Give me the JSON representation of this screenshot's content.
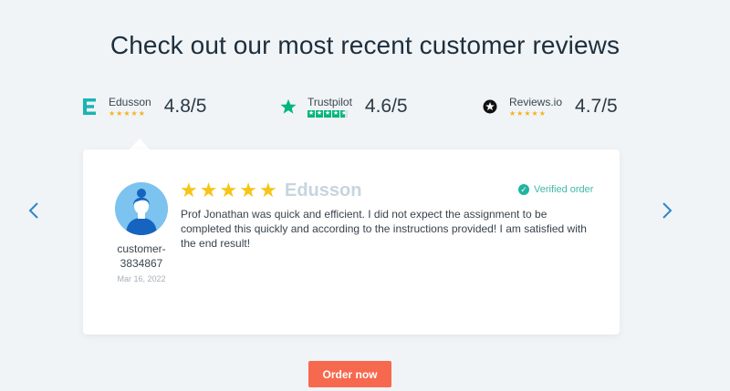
{
  "heading": "Check out our most recent customer reviews",
  "ratings": [
    {
      "name": "Edusson",
      "score": "4.8/5",
      "icon": "edusson-e-icon",
      "color": "#1bb3b6"
    },
    {
      "name": "Trustpilot",
      "score": "4.6/5",
      "icon": "trustpilot-star-icon",
      "color": "#00b67a"
    },
    {
      "name": "Reviews.io",
      "score": "4.7/5",
      "icon": "reviewsio-star-icon",
      "color": "#111111"
    }
  ],
  "review": {
    "customer_name": "customer-3834867",
    "date": "Mar 16, 2022",
    "stars": 5,
    "brand": "Edusson",
    "verified_label": "Verified order",
    "text": "Prof Jonathan was quick and efficient. I did not expect the assignment to be completed this quickly and according to the instructions provided! I am satisfied with the end result!"
  },
  "nav": {
    "prev_icon": "chevron-left-icon",
    "next_icon": "chevron-right-icon"
  },
  "cta": {
    "order_label": "Order now",
    "color": "#f7694e"
  }
}
